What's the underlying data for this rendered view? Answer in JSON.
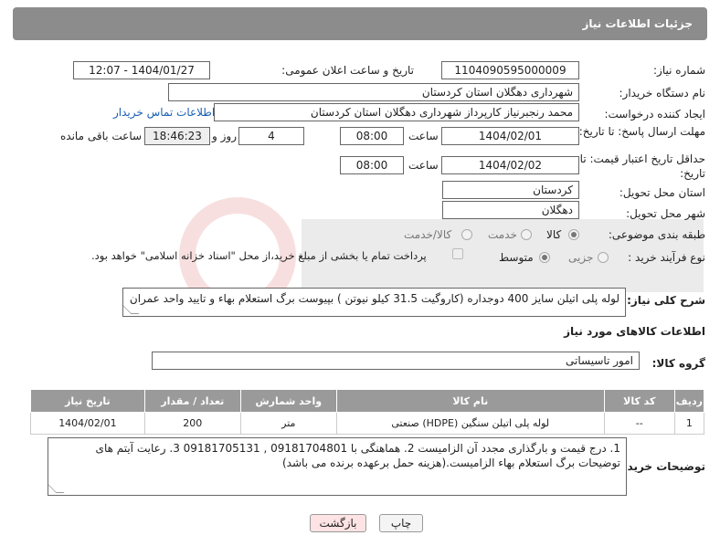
{
  "header": {
    "title": "جزئیات اطلاعات نیاز"
  },
  "need_number": {
    "label": "شماره نیاز:",
    "value": "1104090595000009"
  },
  "announce": {
    "label": "تاریخ و ساعت اعلان عمومی:",
    "value": "1404/01/27 - 12:07"
  },
  "buyer_org": {
    "label": "نام دستگاه خریدار:",
    "value": "شهرداری دهگلان استان کردستان"
  },
  "requester": {
    "label": "ایجاد کننده درخواست:",
    "value": "محمد رنجبرنیاز کارپرداز شهرداری دهگلان استان کردستان",
    "contact_link": "اطلاعات تماس خریدار"
  },
  "deadline": {
    "label": "مهلت ارسال پاسخ: تا تاریخ:",
    "date": "1404/02/01",
    "time_label": "ساعت",
    "time": "08:00",
    "days": "4",
    "days_label": "روز و",
    "remaining": "18:46:23",
    "remaining_label": "ساعت باقی مانده"
  },
  "price_validity": {
    "label": "حداقل تاریخ اعتبار قیمت: تا تاریخ:",
    "date": "1404/02/02",
    "time_label": "ساعت",
    "time": "08:00"
  },
  "delivery_province": {
    "label": "استان محل تحویل:",
    "value": "کردستان"
  },
  "delivery_city": {
    "label": "شهر محل تحویل:",
    "value": "دهگلان"
  },
  "category": {
    "label": "طبقه بندی موضوعی:",
    "options": [
      "کالا",
      "خدمت",
      "کالا/خدمت"
    ],
    "selected": "کالا"
  },
  "purchase_type": {
    "label": "نوع فرآیند خرید :",
    "options": [
      "جزیی",
      "متوسط"
    ],
    "selected": "متوسط",
    "note": "پرداخت تمام یا بخشی از مبلغ خرید،از محل \"اسناد خزانه اسلامی\" خواهد بود."
  },
  "general_desc": {
    "label": "شرح کلی نیاز:",
    "value": "لوله پلی اتیلن سایز 400 دوجداره (کاروگیت 31.5 کیلو نیوتن ) بپیوست برگ استعلام بهاء و تایید واحد عمران"
  },
  "goods_info": {
    "title": "اطلاعات کالاهای مورد نیاز"
  },
  "goods_group": {
    "label": "گروه کالا:",
    "value": "امور تاسیساتی"
  },
  "table": {
    "headers": [
      "ردیف",
      "کد کالا",
      "نام کالا",
      "واحد شمارش",
      "تعداد / مقدار",
      "تاریخ نیاز"
    ],
    "rows": [
      [
        "1",
        "--",
        "لوله پلی اتیلن سنگین (HDPE) صنعتی",
        "متر",
        "200",
        "1404/02/01"
      ]
    ]
  },
  "buyer_notes": {
    "label": "توضیحات خریدار:",
    "line1": "1. درج قیمت و بارگذاری مجدد آن الزامیست 2. هماهنگی با  09181704801     ,  09181705131  3. رعایت آیتم های",
    "line2": "توضیحات برگ استعلام بهاء الزامیست.(هزینه حمل برعهده برنده می باشد)"
  },
  "buttons": {
    "print": "چاپ",
    "back": "بازگشت"
  },
  "colors": {
    "header_bg": "#8c8c8c",
    "table_header_bg": "#9a9a9a",
    "link": "#1a5fb4",
    "back_button_bg": "#fde3e3"
  }
}
